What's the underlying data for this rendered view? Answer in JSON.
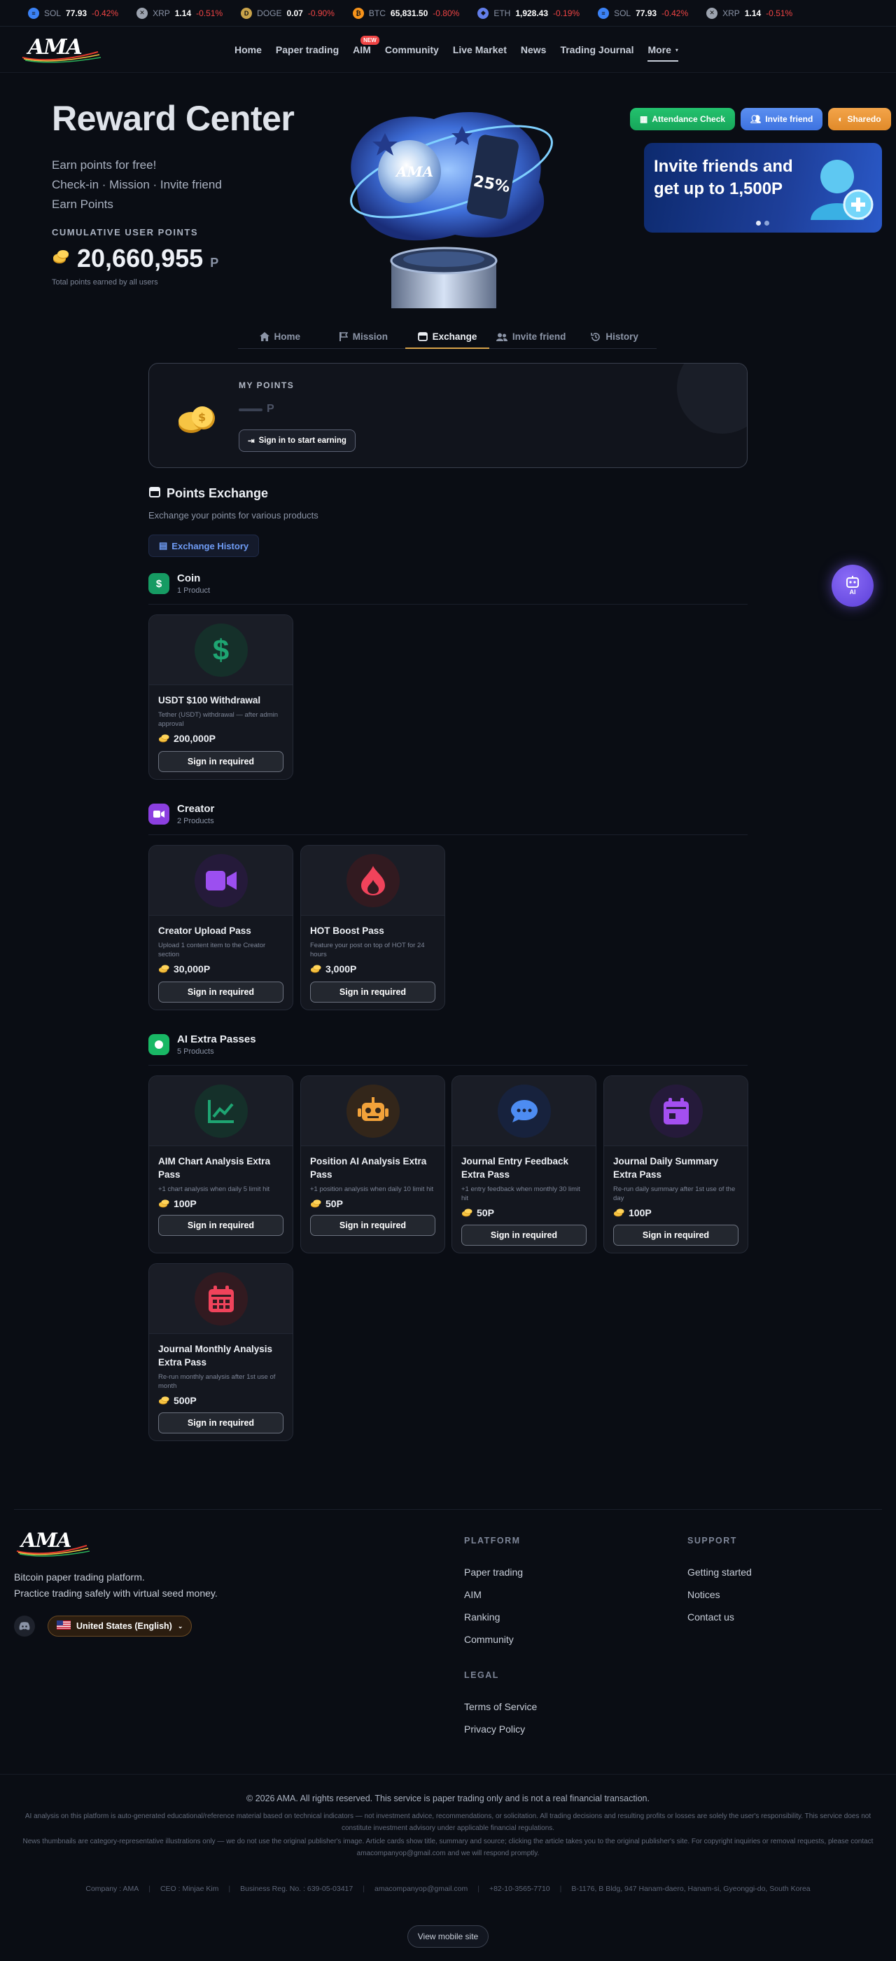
{
  "ticker": [
    {
      "icon": "sol-icon",
      "symbol": "SOL",
      "price": "77.93",
      "change": "-0.42%",
      "color": "#3b82f6",
      "glyph": "≡"
    },
    {
      "icon": "xrp-icon",
      "symbol": "XRP",
      "price": "1.14",
      "change": "-0.51%",
      "color": "#9ca3af",
      "glyph": "✕"
    },
    {
      "icon": "doge-icon",
      "symbol": "DOGE",
      "price": "0.07",
      "change": "-0.90%",
      "color": "#c9a34a",
      "glyph": "D"
    },
    {
      "icon": "btc-icon",
      "symbol": "BTC",
      "price": "65,831.50",
      "change": "-0.80%",
      "color": "#f7931a",
      "glyph": "₿"
    },
    {
      "icon": "eth-icon",
      "symbol": "ETH",
      "price": "1,928.43",
      "change": "-0.19%",
      "color": "#627eea",
      "glyph": "◆"
    },
    {
      "icon": "sol-icon",
      "symbol": "SOL",
      "price": "77.93",
      "change": "-0.42%",
      "color": "#3b82f6",
      "glyph": "≡"
    },
    {
      "icon": "xrp-icon",
      "symbol": "XRP",
      "price": "1.14",
      "change": "-0.51%",
      "color": "#9ca3af",
      "glyph": "✕"
    }
  ],
  "logo_text": "AMA",
  "nav": {
    "home": "Home",
    "paper_trading": "Paper trading",
    "aim": "AIM",
    "aim_badge": "NEW",
    "community": "Community",
    "live_market": "Live Market",
    "news": "News",
    "journal": "Trading Journal",
    "more": "More"
  },
  "hero": {
    "title": "Reward Center",
    "line1": "Earn points for free!",
    "line2": "Check-in · Mission · Invite friend",
    "line3": "Earn Points",
    "cum_label": "CUMULATIVE USER POINTS",
    "cum_value": "20,660,955",
    "cum_unit": "P",
    "cum_note": "Total points earned by all users",
    "art_text1": "AMA",
    "art_text2": "25%"
  },
  "hero_buttons": {
    "attendance": "Attendance Check",
    "invite": "Invite friend",
    "share": "Sharedo"
  },
  "banner": {
    "title": "Invite friends and get up to 1,500P"
  },
  "tabs": [
    {
      "label": "Home",
      "icon": "home-icon"
    },
    {
      "label": "Mission",
      "icon": "flag-icon"
    },
    {
      "label": "Exchange",
      "icon": "store-icon"
    },
    {
      "label": "Invite friend",
      "icon": "users-icon"
    },
    {
      "label": "History",
      "icon": "history-icon"
    }
  ],
  "active_tab": "Exchange",
  "my_points": {
    "label": "MY POINTS",
    "unit": "P",
    "signin": "Sign in to start earning"
  },
  "exchange": {
    "title": "Points Exchange",
    "subtitle": "Exchange your points for various products",
    "history_button": "Exchange History"
  },
  "categories": {
    "coin": {
      "name": "Coin",
      "count": "1 Product"
    },
    "creator": {
      "name": "Creator",
      "count": "2 Products"
    },
    "ai": {
      "name": "AI Extra Passes",
      "count": "5 Products"
    }
  },
  "products": {
    "usdt": {
      "title": "USDT $100 Withdrawal",
      "desc": "Tether (USDT) withdrawal — after admin approval",
      "price": "200,000P",
      "button": "Sign in required"
    },
    "upload": {
      "title": "Creator Upload Pass",
      "desc": "Upload 1 content item to the Creator section",
      "price": "30,000P",
      "button": "Sign in required"
    },
    "hot": {
      "title": "HOT Boost Pass",
      "desc": "Feature your post on top of HOT for 24 hours",
      "price": "3,000P",
      "button": "Sign in required"
    },
    "aim_chart": {
      "title": "AIM Chart Analysis Extra Pass",
      "desc": "+1 chart analysis when daily 5 limit hit",
      "price": "100P",
      "button": "Sign in required"
    },
    "position": {
      "title": "Position AI Analysis Extra Pass",
      "desc": "+1 position analysis when daily 10 limit hit",
      "price": "50P",
      "button": "Sign in required"
    },
    "journal_entry": {
      "title": "Journal Entry Feedback Extra Pass",
      "desc": "+1 entry feedback when monthly 30 limit hit",
      "price": "50P",
      "button": "Sign in required"
    },
    "journal_daily": {
      "title": "Journal Daily Summary Extra Pass",
      "desc": "Re-run daily summary after 1st use of the day",
      "price": "100P",
      "button": "Sign in required"
    },
    "journal_monthly": {
      "title": "Journal Monthly Analysis Extra Pass",
      "desc": "Re-run monthly analysis after 1st use of month",
      "price": "500P",
      "button": "Sign in required"
    }
  },
  "ai_fab": "AI",
  "footer": {
    "tagline1": "Bitcoin paper trading platform.",
    "tagline2": "Practice trading safely with virtual seed money.",
    "language": "United States (English)",
    "platform_h": "PLATFORM",
    "platform": [
      "Paper trading",
      "AIM",
      "Ranking",
      "Community"
    ],
    "legal_h": "LEGAL",
    "legal": [
      "Terms of Service",
      "Privacy Policy"
    ],
    "support_h": "SUPPORT",
    "support": [
      "Getting started",
      "Notices",
      "Contact us"
    ],
    "copyright": "© 2026 AMA. All rights reserved. This service is paper trading only and is not a real financial transaction.",
    "disclaimer1": "AI analysis on this platform is auto-generated educational/reference material based on technical indicators — not investment advice, recommendations, or solicitation. All trading decisions and resulting profits or losses are solely the user's responsibility. This service does not constitute investment advisory under applicable financial regulations.",
    "disclaimer2": "News thumbnails are category-representative illustrations only — we do not use the original publisher's image. Article cards show title, summary and source; clicking the article takes you to the original publisher's site. For copyright inquiries or removal requests, please contact amacompanyop@gmail.com and we will respond promptly.",
    "company": [
      "Company : AMA",
      "CEO : Minjae Kim",
      "Business Reg. No. : 639-05-03417",
      "amacompanyop@gmail.com",
      "+82-10-3565-7710",
      "B-1176, B Bldg, 947 Hanam-daero, Hanam-si, Gyeonggi-do, South Korea"
    ],
    "mobile": "View mobile site"
  }
}
